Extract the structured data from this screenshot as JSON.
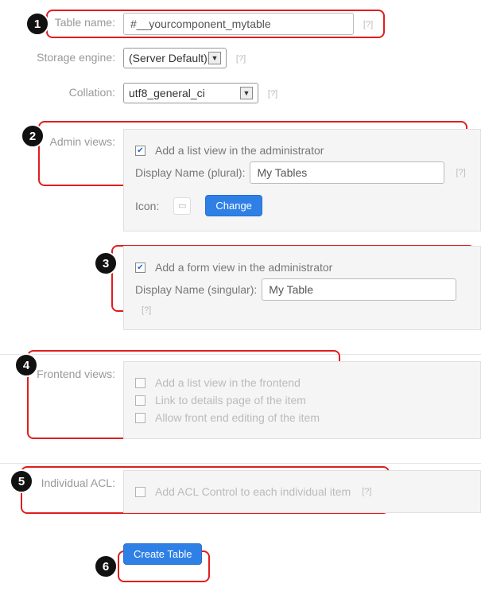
{
  "table_name": {
    "label": "Table name:",
    "value": "#__yourcomponent_mytable"
  },
  "storage_engine": {
    "label": "Storage engine:",
    "value": "(Server Default)"
  },
  "collation": {
    "label": "Collation:",
    "value": "utf8_general_ci"
  },
  "admin_views": {
    "label": "Admin views:",
    "list_view": {
      "checked": true,
      "label": "Add a list view in the administrator"
    },
    "display_plural": {
      "label": "Display Name (plural):",
      "value": "My Tables"
    },
    "icon": {
      "label": "Icon:",
      "change_btn": "Change"
    },
    "form_view": {
      "checked": true,
      "label": "Add a form view in the administrator"
    },
    "display_singular": {
      "label": "Display Name (singular):",
      "value": "My Table"
    }
  },
  "frontend_views": {
    "label": "Frontend views:",
    "list_view": {
      "checked": false,
      "label": "Add a list view in the frontend"
    },
    "link_details": {
      "checked": false,
      "label": "Link to details page of the item"
    },
    "allow_edit": {
      "checked": false,
      "label": "Allow front end editing of the item"
    }
  },
  "individual_acl": {
    "label": "Individual ACL:",
    "add_acl": {
      "checked": false,
      "label": "Add ACL Control to each individual item"
    }
  },
  "create_btn": "Create Table",
  "help": "[?]",
  "badges": {
    "1": "1",
    "2": "2",
    "3": "3",
    "4": "4",
    "5": "5",
    "6": "6"
  }
}
